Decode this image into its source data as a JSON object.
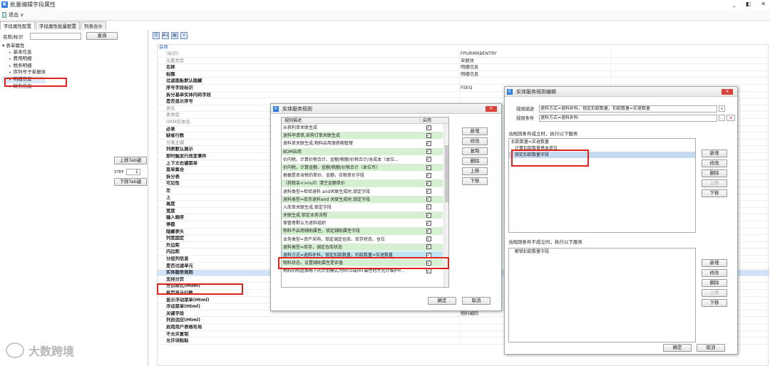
{
  "window": {
    "title": "批量编辑字段属性",
    "min": "_",
    "max": "◧",
    "close": "✕"
  },
  "toolbar": {
    "exit_label": "退出 ∨"
  },
  "tabs": [
    "字段属性配置",
    "字段属性批量配置",
    "列表合计"
  ],
  "left": {
    "search_label": "名称/标识",
    "search_value": "",
    "search_button": "查询",
    "tree_root": "表单属性",
    "tree_items": [
      "基本信息",
      "费用明细",
      "税务明细",
      "序列号子单据体",
      "明细信息",
      "财务信息"
    ],
    "up_button": "上移Tab键",
    "step_label": "STEP",
    "step_value": "1",
    "down_button": "下移Tab键"
  },
  "grid": {
    "category": "杂项",
    "rows": [
      {
        "name": "(标识)",
        "value": "FPURMRBENTRY",
        "gray": true
      },
      {
        "name": "元素类型",
        "value": "单据体",
        "gray": true
      },
      {
        "name": "名称",
        "value": "明细信息",
        "bold": true
      },
      {
        "name": "标题",
        "value": "明细信息",
        "bold": true
      },
      {
        "name": "过滤面板默认隐藏",
        "value": "",
        "bold": true
      },
      {
        "name": "序号字段标识",
        "value": "FSEQ",
        "bold": true
      },
      {
        "name": "拆分基单实体内码字段",
        "value": "",
        "bold": true
      },
      {
        "name": "是否显示序号",
        "value": "",
        "bold": true
      },
      {
        "name": "表名",
        "value": "",
        "gray": true
      },
      {
        "name": "表类型",
        "value": "",
        "gray": true
      },
      {
        "name": "ORM实体名",
        "value": "",
        "gray": true
      },
      {
        "name": "必录",
        "value": "",
        "bold": true
      },
      {
        "name": "缺省行数",
        "value": "",
        "bold": true
      },
      {
        "name": "分录主键",
        "value": "",
        "gray": true
      },
      {
        "name": "列表默认展示",
        "value": "",
        "bold": true
      },
      {
        "name": "即时触发行改变事件",
        "value": "",
        "bold": true
      },
      {
        "name": "上下文右键菜单",
        "value": "",
        "bold": true
      },
      {
        "name": "菜单集合",
        "value": "",
        "bold": true
      },
      {
        "name": "拆分表",
        "value": "",
        "bold": true
      },
      {
        "name": "可见性",
        "value": "",
        "bold": true
      },
      {
        "name": "左",
        "value": "",
        "bold": true
      },
      {
        "name": "上",
        "value": "",
        "bold": true
      },
      {
        "name": "高度",
        "value": "",
        "bold": true
      },
      {
        "name": "宽度",
        "value": "",
        "bold": true
      },
      {
        "name": "输入顺序",
        "value": "",
        "bold": true
      },
      {
        "name": "停靠",
        "value": "",
        "bold": true
      },
      {
        "name": "隐藏表头",
        "value": "",
        "bold": true
      },
      {
        "name": "列宽固定",
        "value": "",
        "bold": true
      },
      {
        "name": "外边距",
        "value": "",
        "bold": true
      },
      {
        "name": "内边距",
        "value": "",
        "bold": true
      },
      {
        "name": "分组列信息",
        "value": "",
        "bold": true
      },
      {
        "name": "是否过滤单元",
        "value": "",
        "bold": true
      },
      {
        "name": "实体服务规则",
        "value": "",
        "bold": true,
        "hl": true
      },
      {
        "name": "支持分页",
        "value": "",
        "bold": true
      },
      {
        "name": "分页样式(Html)",
        "value": "",
        "bold": true
      },
      {
        "name": "每页显示行数",
        "value": "",
        "bold": true
      },
      {
        "name": "显示浮动菜单(Html)",
        "value": "",
        "bold": true
      },
      {
        "name": "浮动菜单(Html)",
        "value": "",
        "bold": true
      },
      {
        "name": "关键字段",
        "value": "物料编码",
        "bold": true
      },
      {
        "name": "列自适应(Html)",
        "value": "",
        "bold": true
      },
      {
        "name": "启用用户表格布局",
        "value": "",
        "bold": true
      },
      {
        "name": "不允许复制",
        "value": "",
        "bold": true
      },
      {
        "name": "允许块粘贴",
        "value": "",
        "bold": true
      }
    ]
  },
  "dialog1": {
    "title": "实体服务规则",
    "col_desc": "规则描述",
    "col_enabled": "启用",
    "rules": [
      {
        "text": "从获利单关联生成",
        "c": "w"
      },
      {
        "text": "退料申请单,采购订单关联生成",
        "c": "g"
      },
      {
        "text": "退料单关联生成,物料启用保质期管理",
        "c": "w"
      },
      {
        "text": "BOM启用",
        "c": "g"
      },
      {
        "text": "价内税，计算价税合计、金额/税额/价税合计/总成本（本位...",
        "c": "w"
      },
      {
        "text": "价内税，计算金额、金额/税额/价税合计（本位币）",
        "c": "g"
      },
      {
        "text": "根据是否含税的单价、金额，合税单价字段",
        "c": "w"
      },
      {
        "text": "（我租会<>null）清空金额单价",
        "c": "g"
      },
      {
        "text": "退料类型=检验退料 and关联生成时,锁定字段",
        "c": "w"
      },
      {
        "text": "退料类型=库存退料and 关联生成时,锁定字段",
        "c": "g"
      },
      {
        "text": "入库单关联生成,锁定字段",
        "c": "w"
      },
      {
        "text": "关联生成,锁定业务流程",
        "c": "g"
      },
      {
        "text": "保管者默认为退料组织",
        "c": "w"
      },
      {
        "text": "物料不启用辅助属性，锁定辅助属性字段",
        "c": "g"
      },
      {
        "text": "业务类型=资产采购，锁定调定仓库、库存状态、仓位",
        "c": "w"
      },
      {
        "text": "退料类型=库存，调定仓库状态",
        "c": "g"
      },
      {
        "text": "退料方式=退料补料，锁定扣款数量，扣款数量=实退数量",
        "c": "s"
      },
      {
        "text": "物料状态，设置辅助属性是否值",
        "c": "g"
      },
      {
        "text": "物料的制造策略下的计划模式为MTO或IHT属性时才允许维护P...",
        "c": "w"
      }
    ],
    "btn_new": "新增",
    "btn_edit": "修改",
    "btn_copy": "复制",
    "btn_delete": "删除",
    "btn_up": "上移",
    "btn_down": "下移",
    "btn_ok": "确定",
    "btn_cancel": "取消"
  },
  "dialog2": {
    "title": "实体服务规则编辑",
    "desc_label": "规则描述",
    "desc_value": "退料方式=退料补料，锁定扣款数量，扣款数量=实退数量",
    "cond_label": "规则条件",
    "cond_value": "退料方式=退料补料",
    "true_label": "当规则条件成立时，执行以下服务",
    "true_items": [
      "扣款数量=实退数量",
      "计算扣款数量基本单位",
      "锁定扣款数量字段"
    ],
    "false_label": "当规则条件不成立时，执行以下服务",
    "false_items": [
      "解锁扣款数量字段"
    ],
    "btn_new": "新增",
    "btn_edit": "修改",
    "btn_delete": "删除",
    "btn_up": "上移",
    "btn_down": "下移",
    "btn_ok": "确定",
    "btn_cancel": "取消"
  },
  "watermark": "大数跨境"
}
